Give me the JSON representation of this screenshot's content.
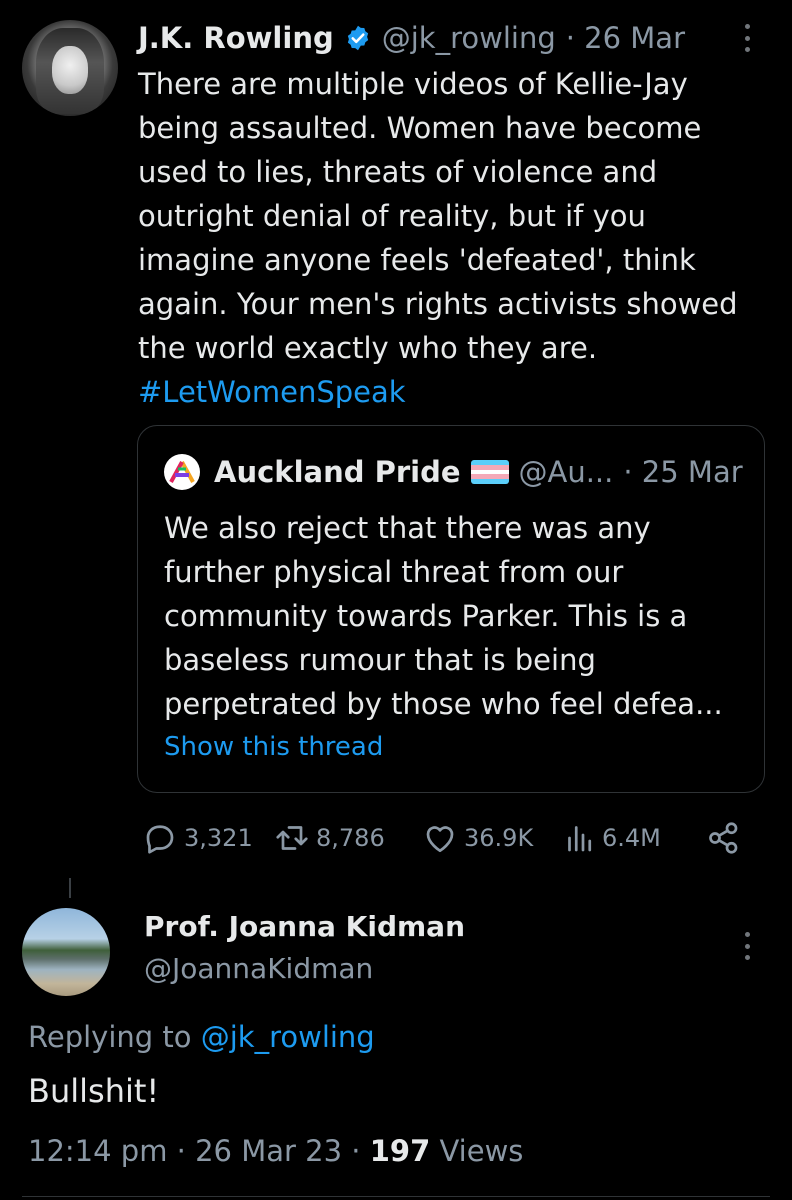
{
  "tweet": {
    "author_name": "J.K. Rowling",
    "handle": "@jk_rowling",
    "date": "· 26 Mar",
    "text": "There are multiple videos of Kellie-Jay\nbeing assaulted. Women have become\nused to lies, threats of violence and\noutright denial of reality, but if you\nimagine anyone feels 'defeated', think\nagain. Your men's rights activists showed\nthe world exactly who they are.",
    "hashtag": "#LetWomenSpeak",
    "verified_icon": "verified-badge-icon"
  },
  "quote": {
    "author_name": "Auckland Pride",
    "handle": "@Au...",
    "date": "· 25 Mar",
    "text": "We also reject that there was any\nfurther physical threat from our\ncommunity towards Parker. This is a\nbaseless rumour that is being\nperpetrated by those who feel defea...",
    "show_thread": "Show this thread",
    "flag_colors": [
      "#5BCEFA",
      "#F5A9B8",
      "#FFFFFF",
      "#F5A9B8",
      "#5BCEFA"
    ]
  },
  "actions": {
    "replies": "3,321",
    "retweets": "8,786",
    "likes": "36.9K",
    "views": "6.4M"
  },
  "reply": {
    "author_name": "Prof. Joanna Kidman",
    "handle": "@JoannaKidman",
    "replying_prefix": "Replying to",
    "replying_to": "@jk_rowling",
    "text": "Bullshit!",
    "time": "12:14 pm · 26 Mar 23 · ",
    "views_count": "197",
    "views_label": " Views"
  },
  "colors": {
    "background": "#000000",
    "text": "#e7e9ea",
    "muted": "#8b98a5",
    "accent": "#1d9bf0"
  }
}
